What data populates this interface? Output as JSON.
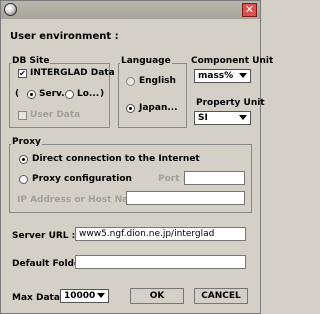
{
  "window": {
    "title": "",
    "close_icon": "close-icon"
  },
  "heading": "User environment :",
  "db_site": {
    "title": "DB Site",
    "interglad_label": "INTERGLAD Data",
    "interglad_checked": true,
    "paren_open": "(",
    "paren_close": ")",
    "server_label": "Serv...",
    "local_label": "Lo...",
    "user_data_label": "User Data"
  },
  "language": {
    "title": "Language",
    "english_label": "English",
    "japanese_label": "Japan..."
  },
  "component_unit": {
    "title": "Component Unit",
    "value": "mass%"
  },
  "property_unit": {
    "title": "Property Unit",
    "value": "SI"
  },
  "proxy": {
    "title": "Proxy",
    "direct_label": "Direct connection to the Internet",
    "config_label": "Proxy configuration",
    "port_label": "Port :",
    "port_value": "",
    "host_label": "IP Address or Host Name :",
    "host_value": ""
  },
  "server_url": {
    "label": "Server URL :",
    "value": "www5.ngf.dion.ne.jp/interglad"
  },
  "default_folder": {
    "label": "Default Folder :",
    "value": ""
  },
  "max_data": {
    "label": "Max Data :",
    "value": "10000"
  },
  "buttons": {
    "ok": "OK",
    "cancel": "CANCEL"
  }
}
